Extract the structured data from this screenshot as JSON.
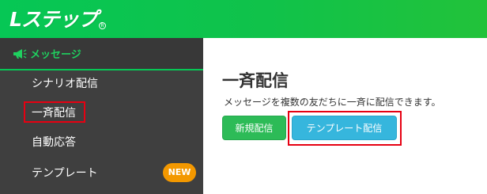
{
  "header": {
    "logo_text": "Lステップ",
    "logo_mark": "R",
    "brand_color": "#06c755"
  },
  "sidebar": {
    "section_label": "メッセージ",
    "section_icon": "megaphone-icon",
    "items": [
      {
        "label": "シナリオ配信"
      },
      {
        "label": "一斉配信",
        "highlighted": true
      },
      {
        "label": "自動応答"
      },
      {
        "label": "テンプレート",
        "badge": "NEW"
      }
    ]
  },
  "main": {
    "title": "一斉配信",
    "description": "メッセージを複数の友だちに一斉に配信できます。",
    "buttons": {
      "new_label": "新規配信",
      "template_label": "テンプレート配信"
    }
  },
  "colors": {
    "highlight": "#e60012",
    "badge": "#f39800",
    "new_button": "#2dbb57",
    "template_button": "#36b6dd"
  }
}
